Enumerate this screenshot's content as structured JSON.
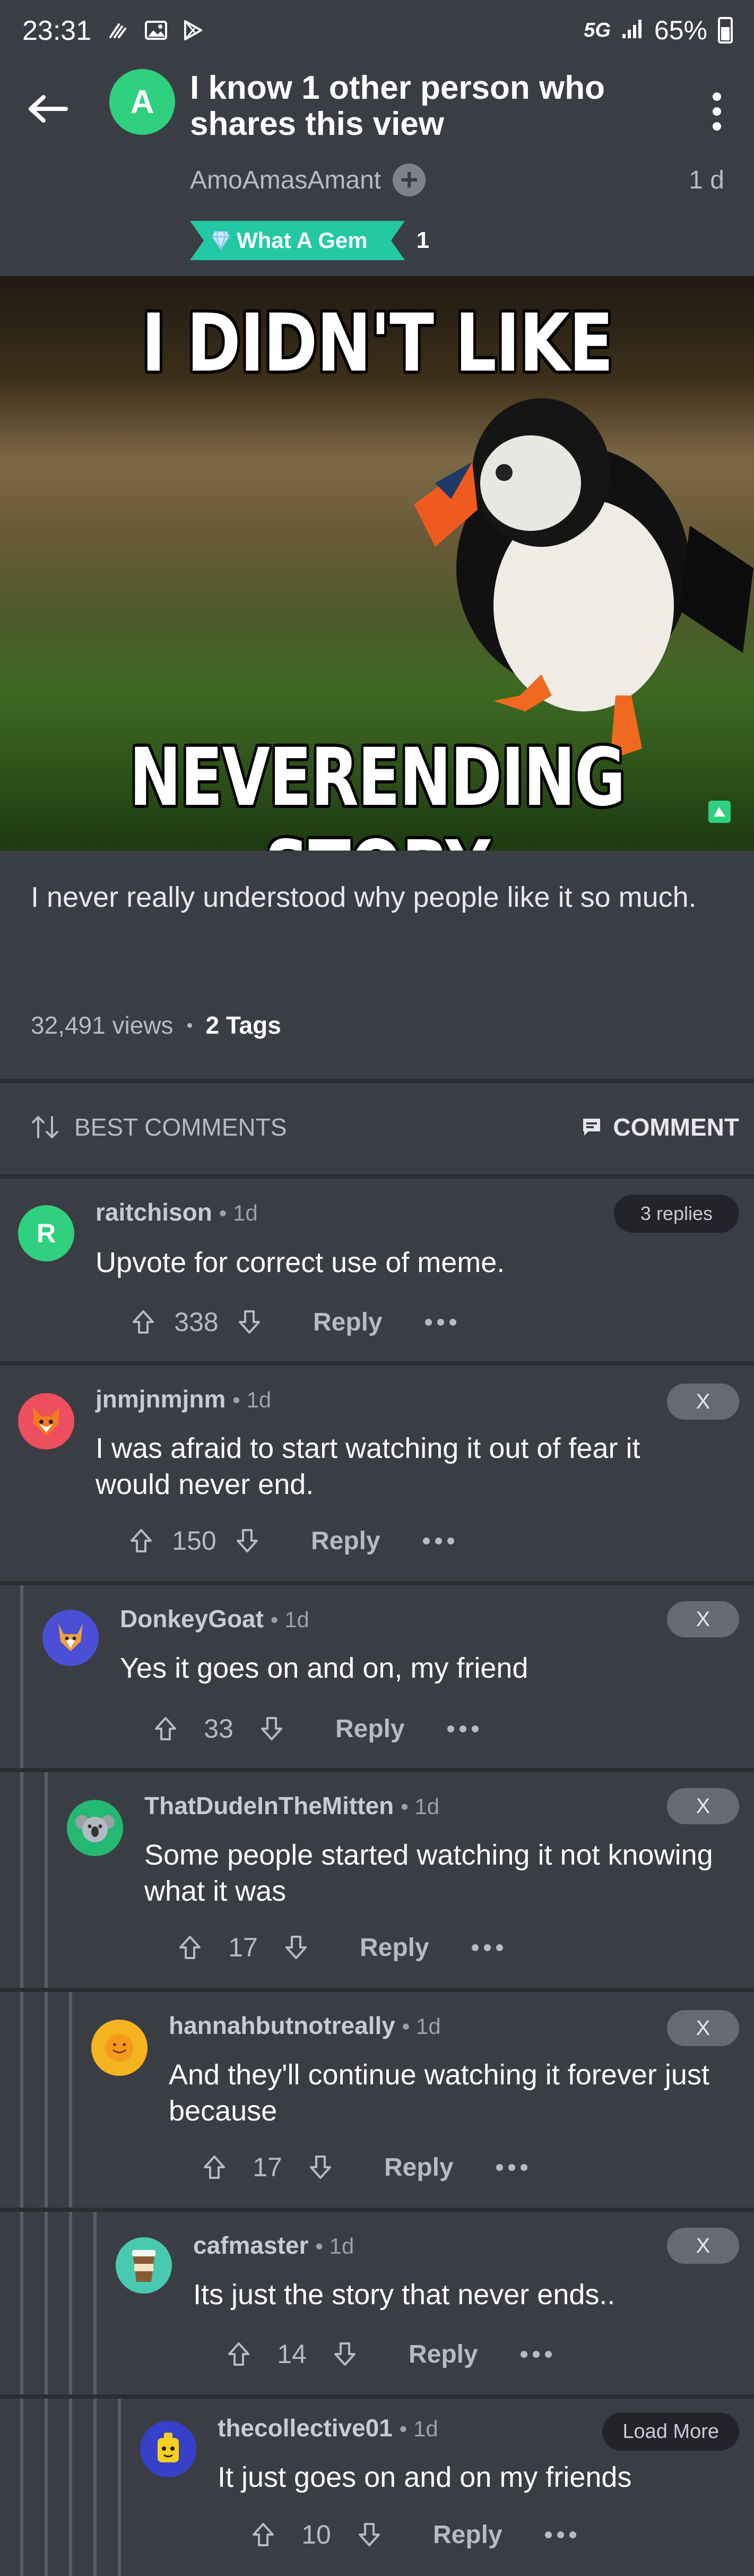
{
  "status_bar": {
    "time": "23:31",
    "network": "5G",
    "battery": "65%"
  },
  "post": {
    "title": "I know 1 other person who shares this view",
    "author_initial": "A",
    "author": "AmoAmasAmant",
    "time": "1 d",
    "award": {
      "label": "What A Gem",
      "count": "1"
    },
    "meme_top_text": "I DIDN'T LIKE",
    "meme_bottom_text": "NEVERENDING STORY",
    "description": "I never really understood why people like it so much.",
    "views": "32,491 views",
    "tags": "2 Tags"
  },
  "comments_header": {
    "sort_label": "BEST COMMENTS",
    "comment_label": "COMMENT"
  },
  "comments": [
    {
      "user": "raitchison",
      "time": "• 1d",
      "text": "Upvote for correct use of meme.",
      "score": "338",
      "reply": "Reply",
      "pill": "3 replies",
      "avatar_initial": "R",
      "avatar_color": "#2fd07f"
    },
    {
      "user": "jnmjnmjnm",
      "time": "• 1d",
      "text": "I was afraid to start watching it out of fear it would never end.",
      "score": "150",
      "reply": "Reply",
      "pill": "X",
      "avatar_color": "#ee4f5f"
    },
    {
      "user": "DonkeyGoat",
      "time": "• 1d",
      "text": "Yes it goes on and on, my friend",
      "score": "33",
      "reply": "Reply",
      "pill": "X",
      "avatar_color": "#4a4fd6"
    },
    {
      "user": "ThatDudeInTheMitten",
      "time": "• 1d",
      "text": "Some people started watching it not knowing what it was",
      "score": "17",
      "reply": "Reply",
      "pill": "X",
      "avatar_color": "#25b872"
    },
    {
      "user": "hannahbutnotreally",
      "time": "• 1d",
      "text": "And they'll continue watching it forever just because",
      "score": "17",
      "reply": "Reply",
      "pill": "X",
      "avatar_color": "#f3b41f"
    },
    {
      "user": "cafmaster",
      "time": "• 1d",
      "text": "Its just the story that never ends..",
      "score": "14",
      "reply": "Reply",
      "pill": "X",
      "avatar_color": "#48c9b0"
    },
    {
      "user": "thecollective01",
      "time": "• 1d",
      "text": "It just goes on and on my friends",
      "score": "10",
      "reply": "Reply",
      "pill": "Load More",
      "avatar_color": "#3740c9"
    }
  ]
}
